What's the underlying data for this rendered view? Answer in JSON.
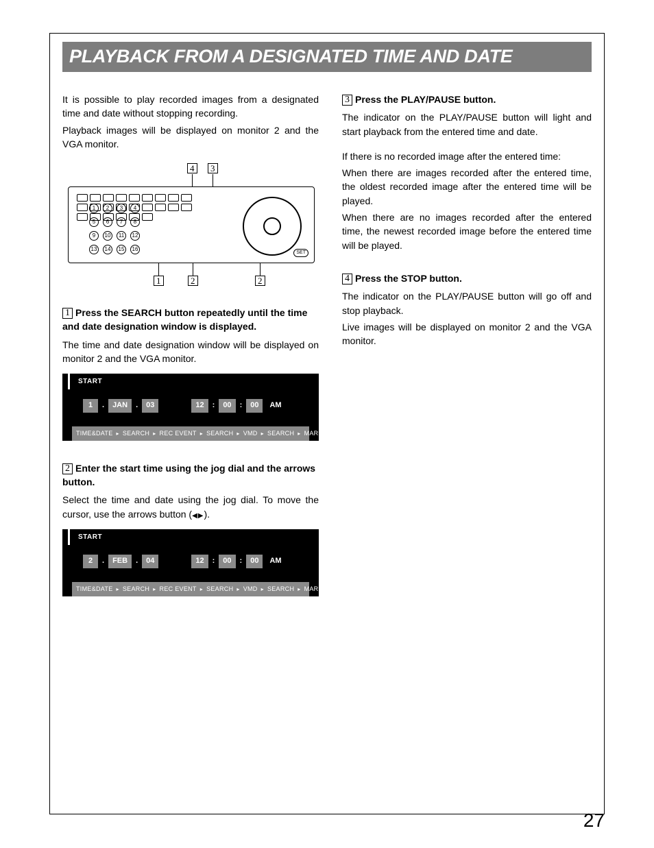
{
  "title": "PLAYBACK FROM A DESIGNATED TIME AND DATE",
  "page_number": "27",
  "intro": {
    "p1": "It is possible to play recorded images from a designated time and date without stopping recording.",
    "p2": "Playback images will be displayed on monitor 2 and the VGA monitor."
  },
  "device_callouts": {
    "top_left": "4",
    "top_right": "3",
    "bottom_a": "1",
    "bottom_b": "2",
    "bottom_c": "2"
  },
  "device_circles": [
    "1",
    "2",
    "3",
    "4",
    "5",
    "6",
    "7",
    "8",
    "9",
    "10",
    "11",
    "12",
    "13",
    "14",
    "15",
    "16"
  ],
  "device_label_set": "SET",
  "steps": {
    "s1": {
      "num": "1",
      "head": "Press the SEARCH button repeatedly until the time and date designation window is displayed.",
      "body": "The time and date designation window will be displayed on monitor 2 and the VGA monitor."
    },
    "s2": {
      "num": "2",
      "head": "Enter the start time using the jog dial and the arrows button.",
      "body_a": "Select the time and date using the jog dial. To move the cursor, use the arrows button (",
      "body_b": ")."
    },
    "s3": {
      "num": "3",
      "head": "Press the PLAY/PAUSE button.",
      "body1": "The indicator on the PLAY/PAUSE button will light and start playback from the entered time and date.",
      "body2": "If there is no recorded image after the entered time:",
      "body3": "When there are images recorded after the entered time, the oldest recorded image after the entered time will be played.",
      "body4": "When there are no images recorded after the entered time, the newest recorded image before the entered time will be played."
    },
    "s4": {
      "num": "4",
      "head": "Press the STOP button.",
      "body1": "The indicator on the PLAY/PAUSE button will go off and stop playback.",
      "body2": "Live images will be displayed on monitor 2 and the VGA monitor."
    }
  },
  "panel_labels": {
    "start": "START",
    "colon": ":"
  },
  "panel1": {
    "day": "1",
    "mon": "JAN",
    "yr": "03",
    "hh": "12",
    "mm": "00",
    "ss": "00",
    "ampm": "AM"
  },
  "panel2": {
    "day": "2",
    "mon": "FEB",
    "yr": "04",
    "hh": "12",
    "mm": "00",
    "ss": "00",
    "ampm": "AM"
  },
  "footer_items": [
    "TIME&DATE",
    "SEARCH",
    "REC EVENT",
    "SEARCH",
    "VMD",
    "SEARCH",
    "MARK"
  ]
}
